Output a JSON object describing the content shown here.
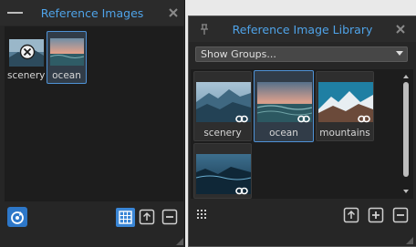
{
  "left_panel": {
    "title": "Reference Images",
    "images": [
      {
        "label": "scenery",
        "selected": false
      },
      {
        "label": "ocean",
        "selected": true
      }
    ]
  },
  "right_panel": {
    "title": "Reference Image Library",
    "dropdown_value": "Show Groups...",
    "images": [
      {
        "label": "scenery",
        "selected": false
      },
      {
        "label": "ocean",
        "selected": true
      },
      {
        "label": "mountains",
        "selected": false
      },
      {
        "label": "",
        "selected": false
      }
    ]
  },
  "colors": {
    "accent": "#4fa3e8",
    "selection_border": "#4f92d6",
    "panel_bg": "#262626"
  }
}
